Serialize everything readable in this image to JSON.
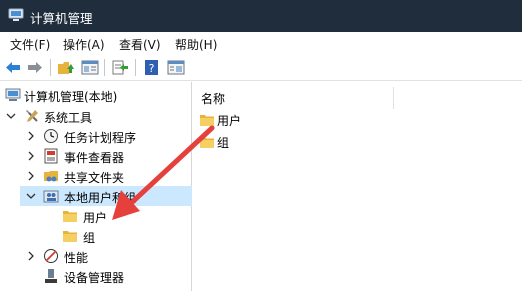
{
  "window": {
    "title": "计算机管理"
  },
  "menu": [
    "文件(F)",
    "操作(A)",
    "查看(V)",
    "帮助(H)"
  ],
  "toolbar": {
    "buttons": [
      "back-arrow-icon",
      "forward-arrow-icon",
      "up-folder-icon",
      "console-tree-icon",
      "export-list-icon",
      "help-icon",
      "show-hide-icon"
    ]
  },
  "tree": {
    "root": "计算机管理(本地)",
    "system_tools": "系统工具",
    "task_scheduler": "任务计划程序",
    "event_viewer": "事件查看器",
    "shared_folders": "共享文件夹",
    "local_users": "本地用户和组",
    "users": "用户",
    "groups": "组",
    "performance": "性能",
    "device_manager": "设备管理器"
  },
  "list": {
    "column_name": "名称",
    "items": [
      "用户",
      "组"
    ]
  },
  "colors": {
    "titlebar": "#1f2d3c",
    "selection": "#cce8ff",
    "annotation_arrow": "#e5403c",
    "folder": "#e8b33a"
  }
}
